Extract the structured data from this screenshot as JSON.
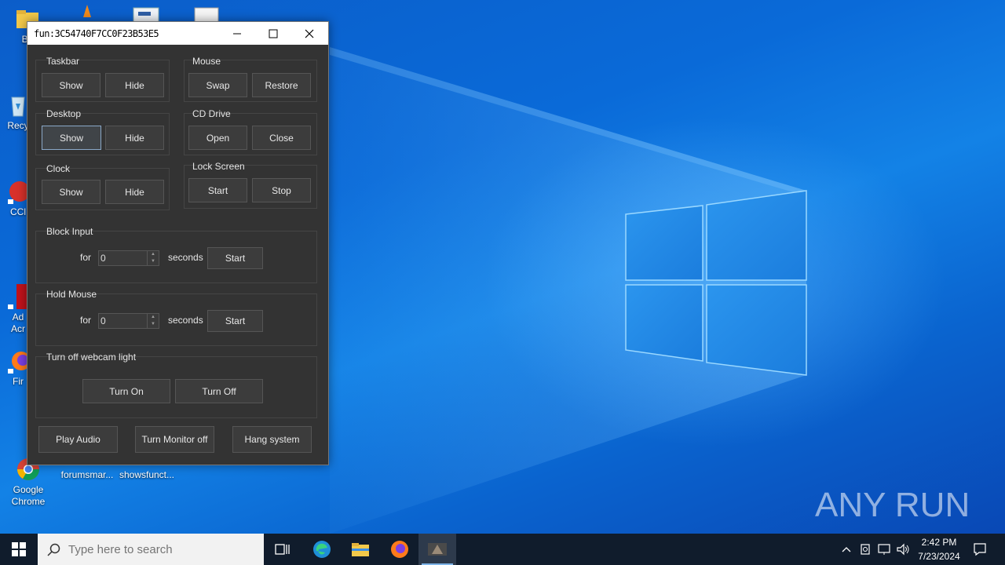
{
  "desktop": {
    "icons": [
      {
        "label": "Bo",
        "icon": "folder-icon"
      },
      {
        "label": "Recy",
        "icon": "recycle-bin-icon"
      },
      {
        "label": "CCl",
        "icon": "ccleaner-icon"
      },
      {
        "label": "Ad\nAcr",
        "icon": "acrobat-icon"
      },
      {
        "label": "Fir",
        "icon": "firefox-icon"
      },
      {
        "label": "Google\nChrome",
        "icon": "chrome-icon"
      },
      {
        "label": "forumsmar...",
        "icon": "document-icon"
      },
      {
        "label": "showsfunct...",
        "icon": "document-icon"
      }
    ],
    "watermark": "ANY RUN"
  },
  "window": {
    "title": "fun:3C54740F7CC0F23B53E5",
    "groups": {
      "taskbar": {
        "label": "Taskbar",
        "show": "Show",
        "hide": "Hide"
      },
      "mouse": {
        "label": "Mouse",
        "swap": "Swap",
        "restore": "Restore"
      },
      "desktop": {
        "label": "Desktop",
        "show": "Show",
        "hide": "Hide"
      },
      "cd_drive": {
        "label": "CD Drive",
        "open": "Open",
        "close": "Close"
      },
      "clock": {
        "label": "Clock",
        "show": "Show",
        "hide": "Hide"
      },
      "lock_screen": {
        "label": "Lock Screen",
        "start": "Start",
        "stop": "Stop"
      },
      "block_input": {
        "label": "Block Input",
        "for": "for",
        "value": "0",
        "seconds": "seconds",
        "start": "Start"
      },
      "hold_mouse": {
        "label": "Hold Mouse",
        "for": "for",
        "value": "0",
        "seconds": "seconds",
        "start": "Start"
      },
      "webcam": {
        "label": "Turn off webcam light",
        "on": "Turn On",
        "off": "Turn Off"
      }
    },
    "bottom": {
      "play_audio": "Play Audio",
      "monitor_off": "Turn Monitor off",
      "hang": "Hang system"
    }
  },
  "taskbar": {
    "search_placeholder": "Type here to search",
    "time": "2:42 PM",
    "date": "7/23/2024"
  },
  "colors": {
    "accent": "#0a64cf",
    "window_bg": "#333333",
    "taskbar_bg": "#101c2c"
  }
}
